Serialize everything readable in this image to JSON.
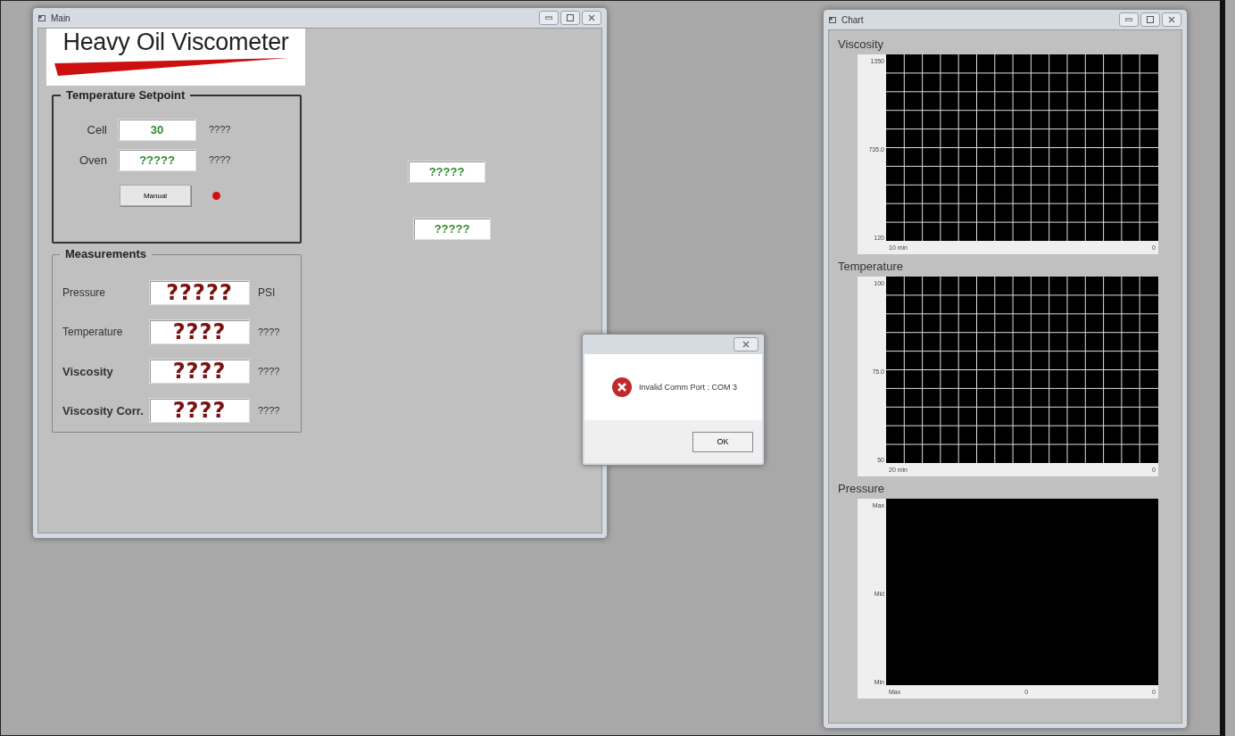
{
  "main_window": {
    "title": "Main",
    "logo": "Heavy Oil Viscometer",
    "temperature_setpoint": {
      "title": "Temperature Setpoint",
      "rows": [
        {
          "label": "Cell",
          "value": "30",
          "unit": "????"
        },
        {
          "label": "Oven",
          "value": "?????",
          "unit": "????"
        }
      ],
      "button": "Manual"
    },
    "side_fields": [
      "?????",
      "?????"
    ],
    "measurements": {
      "title": "Measurements",
      "rows": [
        {
          "label": "Pressure",
          "value": "?????",
          "unit": "PSI",
          "bold": false
        },
        {
          "label": "Temperature",
          "value": "????",
          "unit": "????",
          "bold": false
        },
        {
          "label": "Viscosity",
          "value": "????",
          "unit": "????",
          "bold": true
        },
        {
          "label": "Viscosity Corr.",
          "value": "????",
          "unit": "????",
          "bold": true
        }
      ]
    }
  },
  "dialog": {
    "message": "Invalid Comm Port : COM 3",
    "button": "OK"
  },
  "chart_window": {
    "title": "Chart",
    "panels": [
      {
        "title": "Viscosity",
        "y_labels": [
          "1350",
          "735.0",
          "120"
        ],
        "x_labels": [
          "10 min",
          "0"
        ],
        "grid": true
      },
      {
        "title": "Temperature",
        "y_labels": [
          "100",
          "75.0",
          "50"
        ],
        "x_labels": [
          "20 min",
          "0"
        ],
        "grid": true
      },
      {
        "title": "Pressure",
        "y_labels": [
          "Max",
          "Mid",
          "Min"
        ],
        "x_labels": [
          "Max",
          "0",
          "0"
        ],
        "grid": false
      }
    ]
  }
}
